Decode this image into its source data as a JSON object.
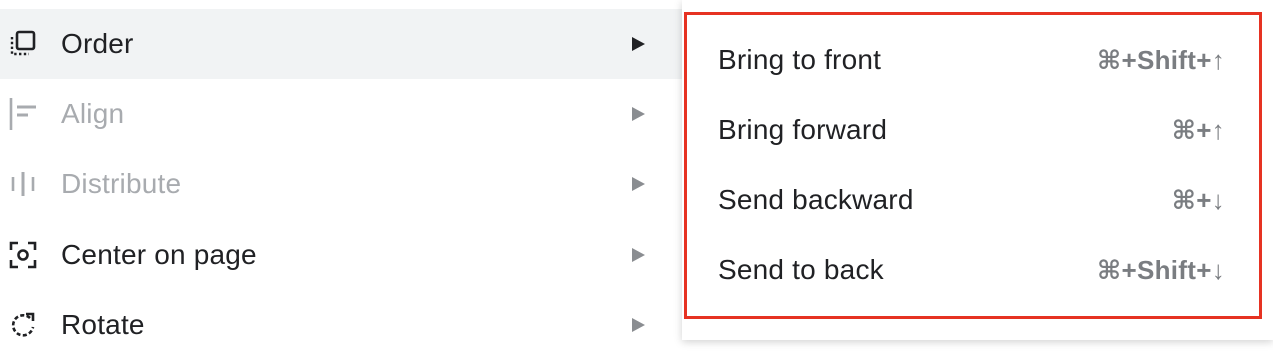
{
  "menu": {
    "items": [
      {
        "label": "Order",
        "icon": "order-icon",
        "state": "highlighted"
      },
      {
        "label": "Align",
        "icon": "align-icon",
        "state": "disabled"
      },
      {
        "label": "Distribute",
        "icon": "distribute-icon",
        "state": "disabled"
      },
      {
        "label": "Center on page",
        "icon": "center-on-page-icon",
        "state": "enabled"
      },
      {
        "label": "Rotate",
        "icon": "rotate-icon",
        "state": "enabled"
      }
    ],
    "submenu_arrow_icon": "triangle-right-icon"
  },
  "submenu": {
    "items": [
      {
        "label": "Bring to front",
        "shortcut": "⌘+Shift+↑"
      },
      {
        "label": "Bring forward",
        "shortcut": "⌘+↑"
      },
      {
        "label": "Send backward",
        "shortcut": "⌘+↓"
      },
      {
        "label": "Send to back",
        "shortcut": "⌘+Shift+↓"
      }
    ]
  },
  "colors": {
    "highlight_bg": "#f1f3f4",
    "text": "#202124",
    "disabled_text": "#a8abaf",
    "shortcut_text": "#7a7d81",
    "annotation_border": "#e63222"
  }
}
